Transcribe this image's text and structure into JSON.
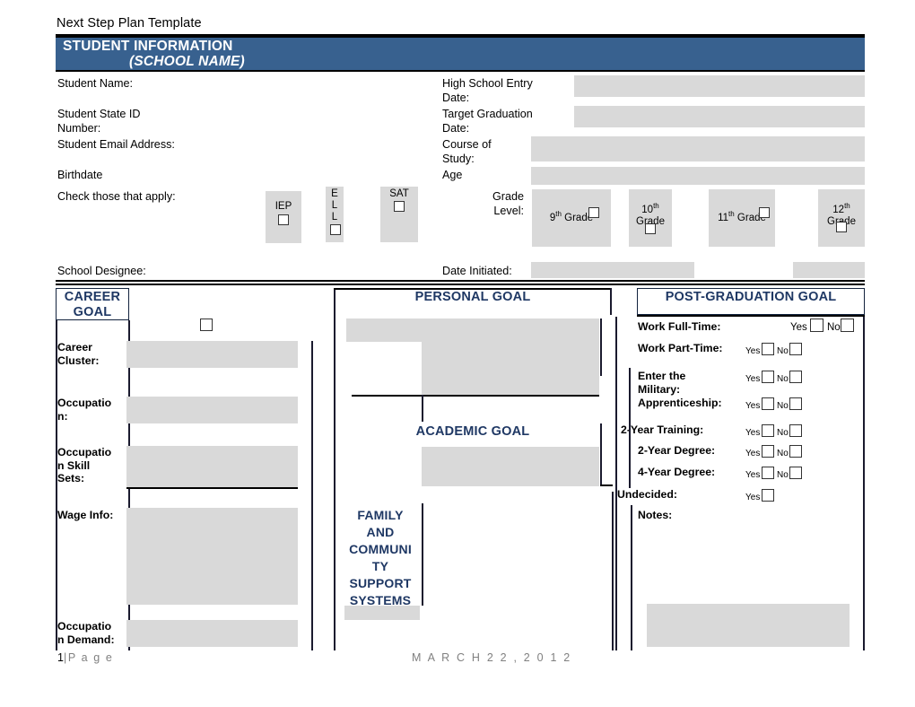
{
  "document": {
    "title": "Next Step Plan Template"
  },
  "banner": {
    "line1": "STUDENT INFORMATION",
    "line2": "(SCHOOL NAME)",
    "color": "#38618f"
  },
  "student_info": {
    "left_fields": [
      {
        "label": "Student Name:"
      },
      {
        "label": "Student State ID\nNumber:"
      },
      {
        "label": "Student Email Address:"
      },
      {
        "label": "Birthdate"
      }
    ],
    "right_fields": [
      {
        "label": "High School Entry\nDate:"
      },
      {
        "label": "Target Graduation\nDate:"
      },
      {
        "label": "Course of\nStudy:"
      },
      {
        "label": "Age"
      }
    ],
    "check_prompt": "Check those that apply:",
    "check_options": [
      {
        "name": "IEP",
        "display": "IEP",
        "orientation": "horizontal"
      },
      {
        "name": "ELL",
        "display": "E\nL\nL",
        "orientation": "vertical"
      },
      {
        "name": "SAT",
        "display": "SAT",
        "orientation": "horizontal"
      }
    ],
    "grade_level_label": "Grade\nLevel:",
    "grade_options": [
      {
        "number": "9",
        "sup": "th",
        "suffix": " Grade",
        "layout": "inline"
      },
      {
        "number": "10",
        "sup": "th",
        "suffix": "Grade",
        "layout": "stacked"
      },
      {
        "number": "11",
        "sup": "th",
        "suffix": " Grade",
        "layout": "inline"
      },
      {
        "number": "12",
        "sup": "th",
        "suffix": "Grade",
        "layout": "stacked"
      }
    ],
    "designee_label": "School Designee:",
    "date_initiated_label": "Date Initiated:"
  },
  "career_goal": {
    "title": "CAREER\nGOAL",
    "fields": [
      {
        "label": "Career\nCluster:"
      },
      {
        "label": "Occupatio\nn:"
      },
      {
        "label": "Occupatio\nn Skill\nSets:"
      },
      {
        "label": "Wage Info:"
      },
      {
        "label": "Occupatio\nn Demand:"
      }
    ]
  },
  "personal_goal": {
    "title": "PERSONAL GOAL"
  },
  "academic_goal": {
    "title": "ACADEMIC GOAL"
  },
  "family_support": {
    "title": "FAMILY\nAND\nCOMMUNI\nTY\nSUPPORT\nSYSTEMS"
  },
  "post_graduation_goal": {
    "title": "POST-GRADUATION GOAL",
    "yes_label": "Yes",
    "no_label": "No",
    "rows": [
      {
        "label": "Work Full-Time:",
        "has_no": true,
        "size": "big",
        "indent": 0
      },
      {
        "label": "Work Part-Time:",
        "has_no": true,
        "size": "small",
        "indent": 0
      },
      {
        "label": "Enter the\nMilitary:",
        "has_no": true,
        "size": "small",
        "indent": 0
      },
      {
        "label": "Apprenticeship:",
        "has_no": true,
        "size": "small",
        "indent": 0
      },
      {
        "label": "2-Year Training:",
        "has_no": true,
        "size": "small",
        "indent": 0
      },
      {
        "label": "2-Year Degree:",
        "has_no": true,
        "size": "small",
        "indent": 1
      },
      {
        "label": "4-Year Degree:",
        "has_no": true,
        "size": "small",
        "indent": 1
      },
      {
        "label": "Undecided:",
        "has_no": false,
        "size": "small",
        "indent": 0
      }
    ],
    "notes_label": "Notes:"
  },
  "footer": {
    "page_number": "1",
    "page_separator": "|",
    "page_word": "P a g e",
    "date": "M A R C H  2 2 ,  2 0 1 2"
  }
}
